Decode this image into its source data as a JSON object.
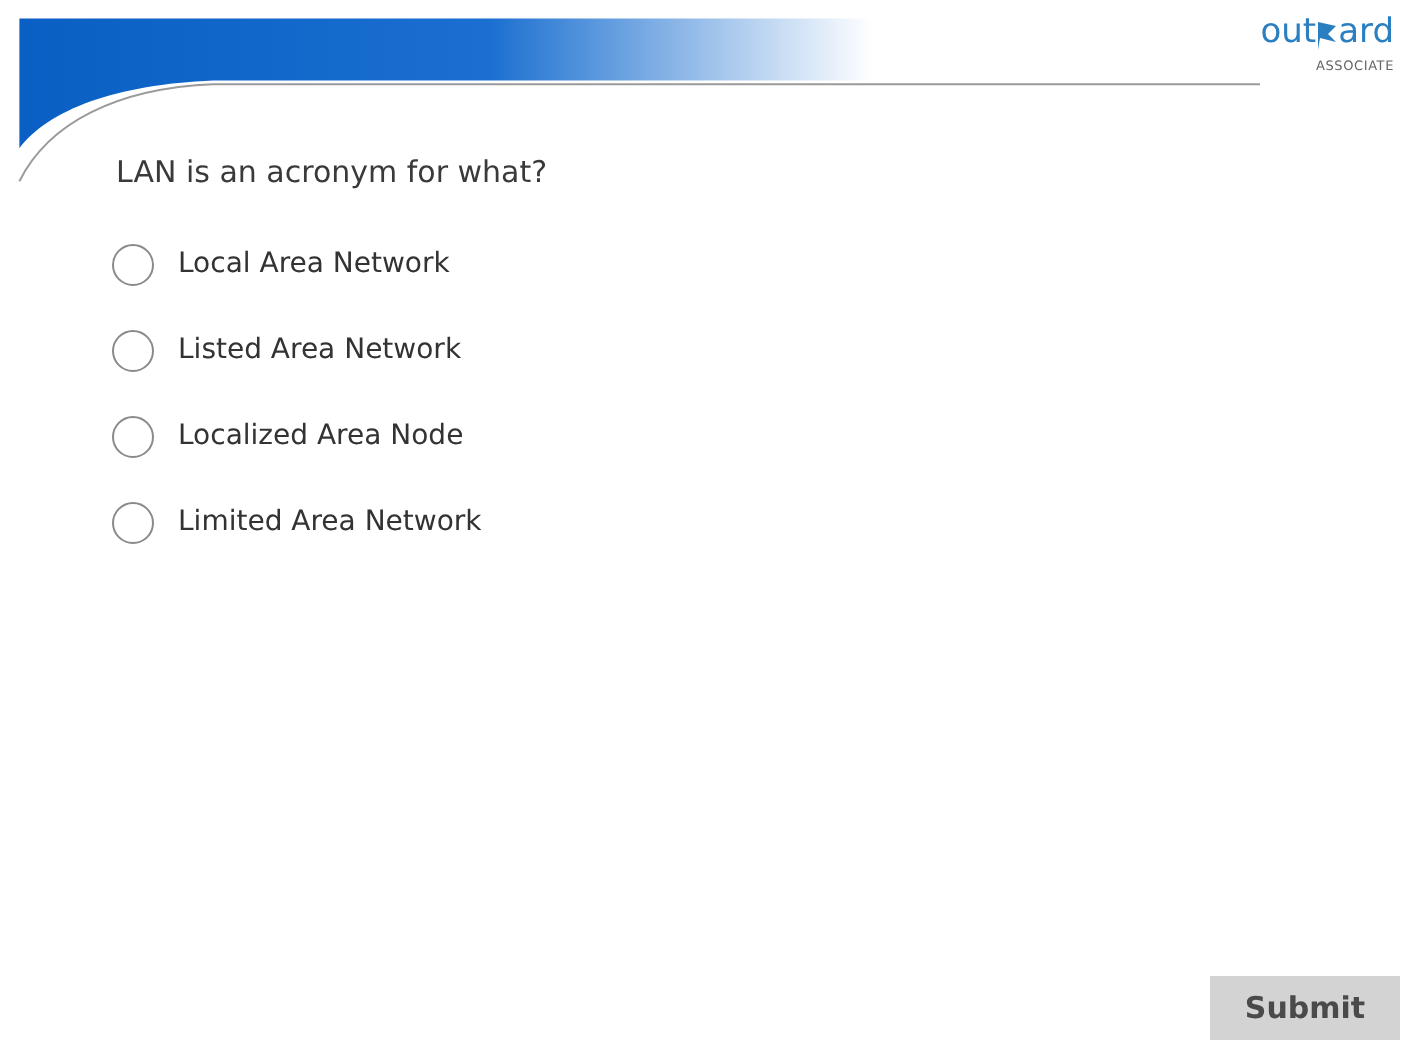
{
  "logo": {
    "before": "out",
    "after": "ard",
    "tagline": "ASSOCIATE"
  },
  "question": "LAN is an acronym for what?",
  "options": [
    {
      "label": "Local Area Network",
      "selected": false
    },
    {
      "label": "Listed Area Network",
      "selected": false
    },
    {
      "label": "Localized Area Node",
      "selected": false
    },
    {
      "label": "Limited Area Network",
      "selected": false
    }
  ],
  "submit": "Submit"
}
